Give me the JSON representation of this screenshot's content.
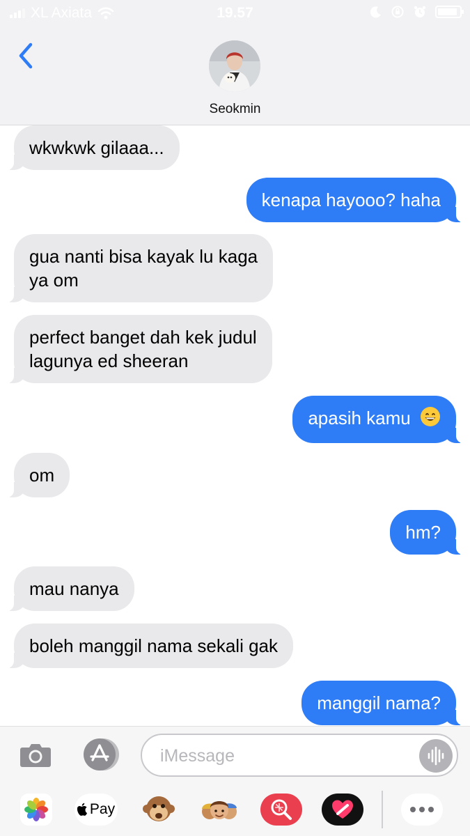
{
  "status_bar": {
    "carrier": "XL Axiata",
    "time": "19.57",
    "battery_level": 0.9
  },
  "header": {
    "contact_name": "Seokmin"
  },
  "messages": [
    {
      "direction": "incoming",
      "text": "wkwkwk gilaaa..."
    },
    {
      "direction": "outgoing",
      "text": "kenapa hayooo? haha"
    },
    {
      "direction": "incoming",
      "lines": [
        "gua nanti bisa kayak lu kaga",
        "ya om"
      ]
    },
    {
      "direction": "incoming",
      "lines": [
        "perfect banget dah kek judul",
        "lagunya ed sheeran"
      ]
    },
    {
      "direction": "outgoing",
      "text": "apasih kamu",
      "emoji": "😄"
    },
    {
      "direction": "incoming",
      "text": "om"
    },
    {
      "direction": "outgoing",
      "text": "hm?"
    },
    {
      "direction": "incoming",
      "text": "mau nanya"
    },
    {
      "direction": "incoming",
      "text": "boleh manggil nama sekali gak"
    },
    {
      "direction": "outgoing",
      "text": "manggil nama?"
    }
  ],
  "compose": {
    "placeholder": "iMessage"
  },
  "app_drawer": {
    "items": [
      "photos-icon",
      "apple-pay",
      "monkey-icon",
      "memoji-icon",
      "image-search-icon",
      "digital-touch-icon",
      "more-icon"
    ],
    "apple_pay_label": "Pay"
  },
  "colors": {
    "outgoing_bubble": "#2e7cf6",
    "incoming_bubble": "#e9e9eb",
    "accent": "#2e7cf6"
  }
}
